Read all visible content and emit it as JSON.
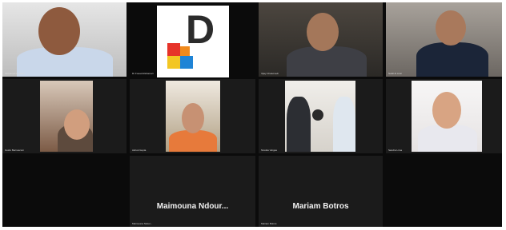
{
  "meeting": {
    "participants": [
      {
        "name": "Mohamed Al Jaber"
      },
      {
        "name": "Dr Fouad Alshamari"
      },
      {
        "name": "Vijay Chaturvedi"
      },
      {
        "name": "Nabil Al Amir"
      },
      {
        "name": "Guido Bernasconi"
      },
      {
        "name": "Ashok Gupta"
      },
      {
        "name": "Nicolás Vargas"
      },
      {
        "name": "Sandra Lima"
      },
      {
        "name": "Maimouna Ndour..."
      },
      {
        "name": "Mariam Botros"
      }
    ],
    "small_labels": [
      "Mohamed Al Jaber",
      "Dr Fouad Alshamari",
      "Vijay Chaturvedi",
      "Nabil Al Amir",
      "Guido Bernasconi",
      "Ashok Gupta",
      "Nicolás Vargas",
      "Sandra Lima",
      "Maimouna Ndour...",
      "Mariam Botros"
    ]
  },
  "colors": {
    "frame_bg": "#0b0b0b",
    "tile_bg": "#1b1b1b",
    "logo_red": "#e63329",
    "logo_blue": "#1f84d6",
    "logo_yellow": "#f3c623",
    "logo_orange": "#f08a1c"
  },
  "logo_letter": "D"
}
